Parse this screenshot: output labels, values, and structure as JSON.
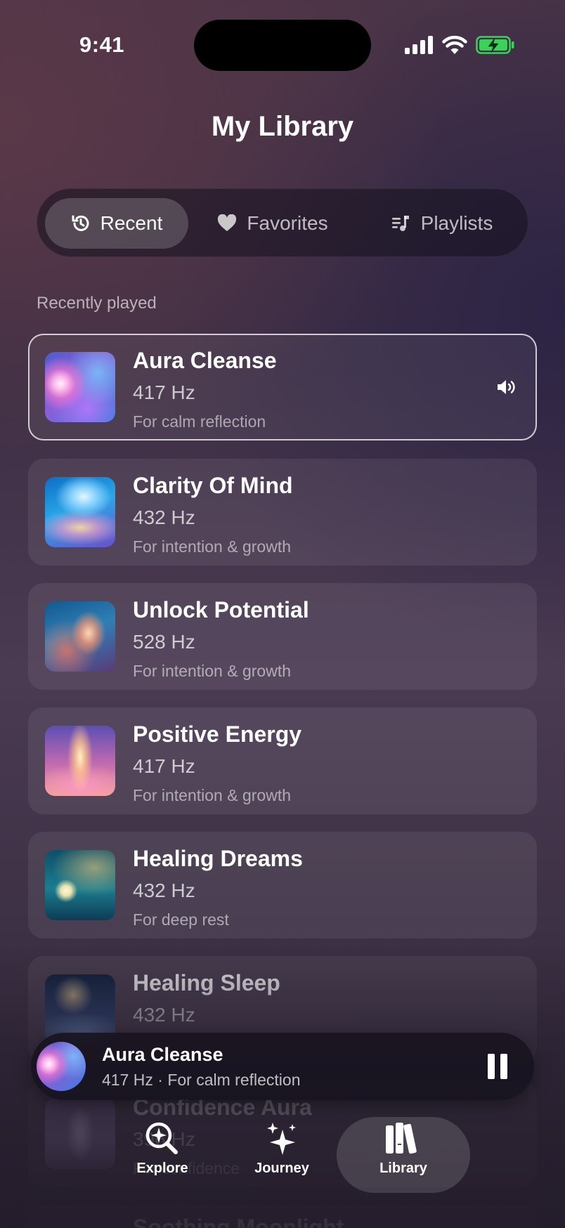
{
  "status_bar": {
    "time": "9:41"
  },
  "header": {
    "title": "My Library"
  },
  "tabs": [
    {
      "label": "Recent",
      "icon": "history-icon",
      "active": true
    },
    {
      "label": "Favorites",
      "icon": "heart-icon",
      "active": false
    },
    {
      "label": "Playlists",
      "icon": "playlist-icon",
      "active": false
    }
  ],
  "section": {
    "label": "Recently played"
  },
  "tracks": [
    {
      "title": "Aura Cleanse",
      "hz": "417 Hz",
      "desc": "For calm reflection",
      "playing": true
    },
    {
      "title": "Clarity Of Mind",
      "hz": "432 Hz",
      "desc": "For intention & growth"
    },
    {
      "title": "Unlock Potential",
      "hz": "528 Hz",
      "desc": "For intention & growth"
    },
    {
      "title": "Positive Energy",
      "hz": "417 Hz",
      "desc": "For intention & growth"
    },
    {
      "title": "Healing Dreams",
      "hz": "432 Hz",
      "desc": "For deep rest"
    },
    {
      "title": "Healing Sleep",
      "hz": "432 Hz",
      "desc": ""
    },
    {
      "title": "Confidence Aura",
      "hz": "396 Hz",
      "desc": "For confidence"
    },
    {
      "title": "Soothing Moonlight",
      "hz": "",
      "desc": ""
    }
  ],
  "mini_player": {
    "title": "Aura Cleanse",
    "subtitle": "417 Hz · For calm reflection",
    "state": "playing"
  },
  "bottom_nav": [
    {
      "label": "Explore",
      "icon": "explore-search-icon"
    },
    {
      "label": "Journey",
      "icon": "sparkles-icon"
    },
    {
      "label": "Library",
      "icon": "library-books-icon",
      "active": true
    }
  ],
  "colors": {
    "accent_battery": "#3ad35a"
  }
}
